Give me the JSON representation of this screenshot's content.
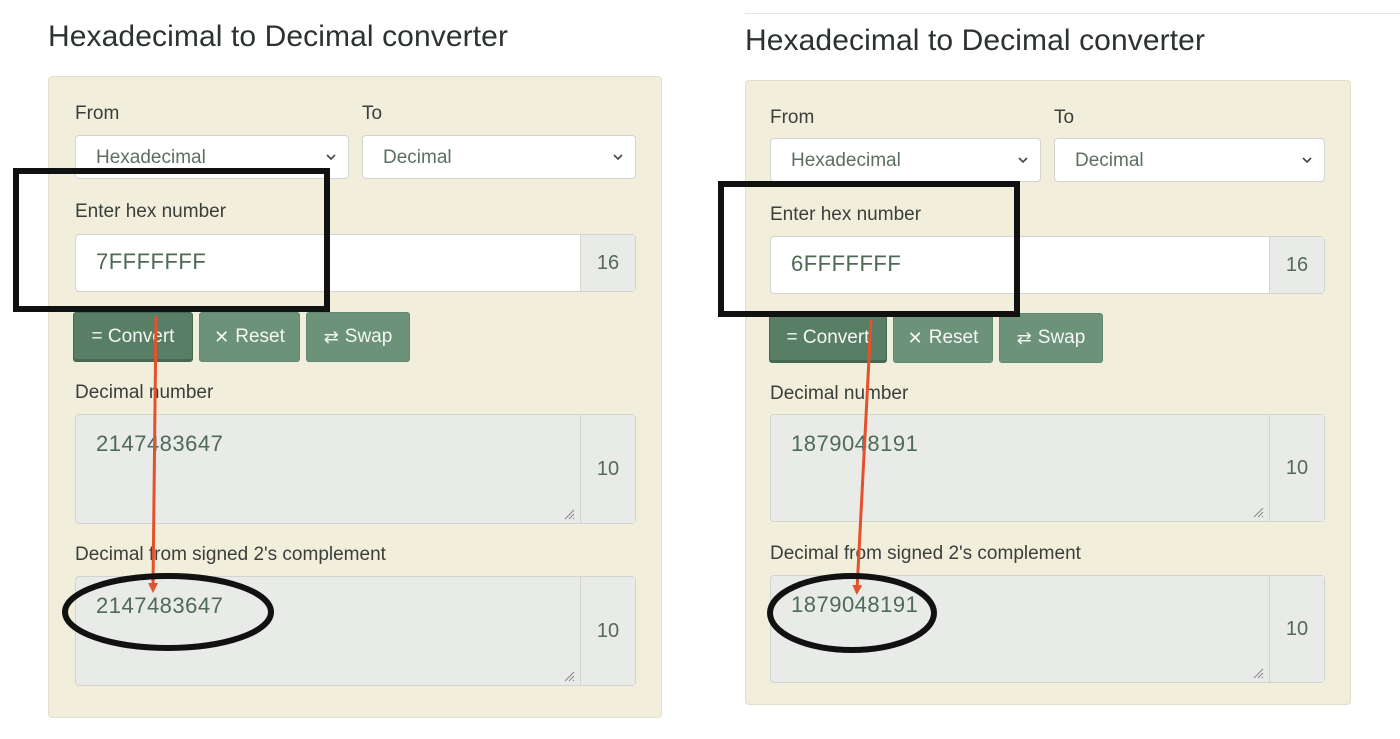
{
  "converters": [
    {
      "title": "Hexadecimal to Decimal converter",
      "from_label": "From",
      "from_value": "Hexadecimal",
      "to_label": "To",
      "to_value": "Decimal",
      "input_label": "Enter hex number",
      "input_value": "7FFFFFFF",
      "input_base": "16",
      "convert_label": "= Convert",
      "reset_label": "Reset",
      "swap_label": "Swap",
      "decimal_label": "Decimal number",
      "decimal_value": "2147483647",
      "decimal_base": "10",
      "signed_label": "Decimal from signed 2's complement",
      "signed_value": "2147483647",
      "signed_base": "10"
    },
    {
      "title": "Hexadecimal to Decimal converter",
      "from_label": "From",
      "from_value": "Hexadecimal",
      "to_label": "To",
      "to_value": "Decimal",
      "input_label": "Enter hex number",
      "input_value": "6FFFFFFF",
      "input_base": "16",
      "convert_label": "= Convert",
      "reset_label": "Reset",
      "swap_label": "Swap",
      "decimal_label": "Decimal number",
      "decimal_value": "1879048191",
      "decimal_base": "10",
      "signed_label": "Decimal from signed 2's complement",
      "signed_value": "1879048191",
      "signed_base": "10"
    }
  ],
  "colors": {
    "card_bg": "#f1efdc",
    "button": "#6c9279",
    "button_primary": "#587e66",
    "annotation_box": "#111111",
    "annotation_arrow": "#e4512a"
  },
  "icons": {
    "reset": "times-icon",
    "swap": "swap-arrows-icon",
    "select": "chevron-down-icon",
    "resize": "resize-grip-icon"
  }
}
